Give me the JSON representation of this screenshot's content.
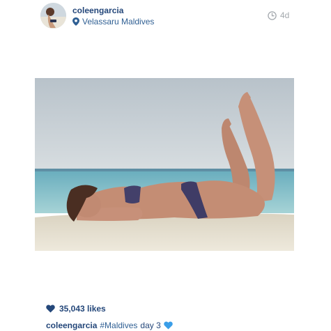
{
  "post": {
    "username": "coleengarcia",
    "location": "Velassaru Maldives",
    "time_ago": "4d",
    "likes": "35,043 likes",
    "caption_user": "coleengarcia",
    "caption_hashtag": "#Maldives",
    "caption_text": "day 3"
  },
  "icons": {
    "location": "location-pin-icon",
    "time": "clock-icon",
    "likes": "heart-icon",
    "caption_emoji": "blue-heart-icon"
  },
  "colors": {
    "username": "#24477a",
    "link": "#2f5f93",
    "muted": "#a3a8ad",
    "emoji": "#3a9ee8"
  }
}
